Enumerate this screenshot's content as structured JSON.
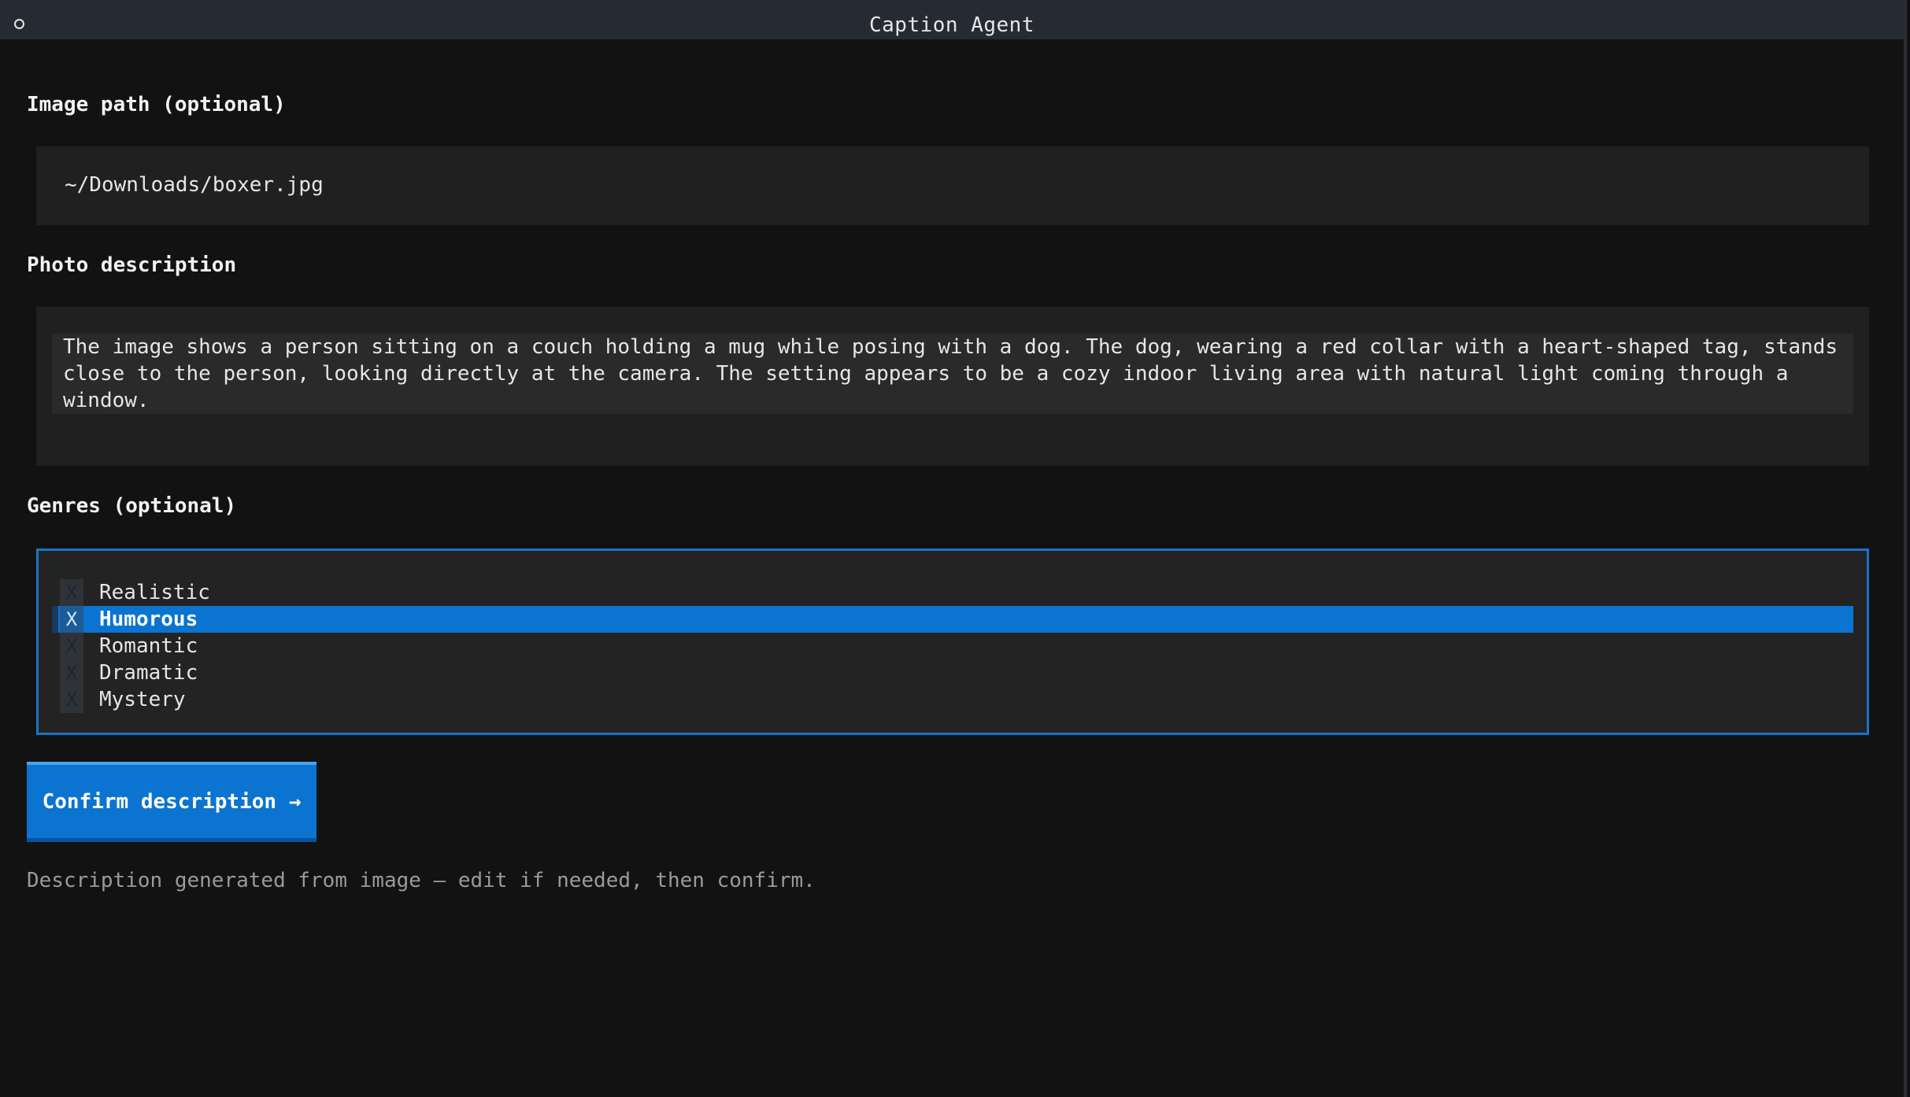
{
  "window": {
    "title": "Caption Agent"
  },
  "image_path": {
    "label": "Image path (optional)",
    "value": "~/Downloads/boxer.jpg"
  },
  "description": {
    "label": "Photo description",
    "value": "The image shows a person sitting on a couch holding a mug while posing with a dog. The dog, wearing a red collar with a heart-shaped tag, stands close to the person, looking directly at the camera. The setting appears to be a cozy indoor living area with natural light coming through a window."
  },
  "genres": {
    "label": "Genres (optional)",
    "check_mark": "X",
    "items": [
      {
        "label": "Realistic",
        "highlighted": false
      },
      {
        "label": "Humorous",
        "highlighted": true
      },
      {
        "label": "Romantic",
        "highlighted": false
      },
      {
        "label": "Dramatic",
        "highlighted": false
      },
      {
        "label": "Mystery",
        "highlighted": false
      }
    ]
  },
  "confirm_button": {
    "label": "Confirm description →"
  },
  "status": {
    "text": "Description generated from image — edit if needed, then confirm."
  },
  "colors": {
    "accent": "#0a74d0",
    "background": "#121212",
    "titlebar": "#262b33"
  },
  "icons": {
    "window_control": "circle-icon",
    "arrow": "arrow-right-icon"
  }
}
